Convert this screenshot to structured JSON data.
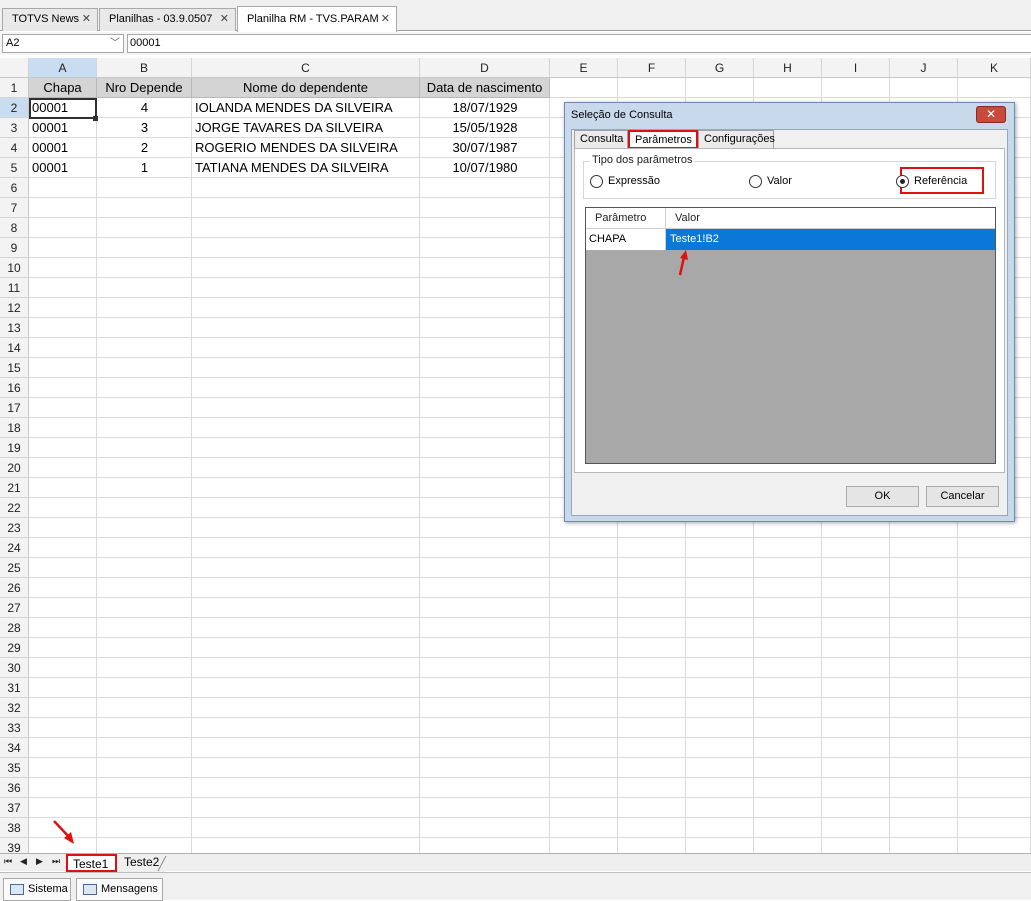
{
  "doc_tabs": [
    {
      "label": "TOTVS News"
    },
    {
      "label": "Planilhas - 03.9.0507"
    },
    {
      "label": "Planilha RM - TVS.PARAM"
    }
  ],
  "formula_bar": {
    "cell_ref": "A2",
    "value": "00001"
  },
  "columns": [
    "A",
    "B",
    "C",
    "D",
    "E",
    "F",
    "G",
    "H",
    "I",
    "J",
    "K"
  ],
  "rows": [
    "1",
    "2",
    "3",
    "4",
    "5",
    "6",
    "7",
    "8",
    "9",
    "10",
    "11",
    "12",
    "13",
    "14",
    "15",
    "16",
    "17",
    "18",
    "19",
    "20",
    "21",
    "22",
    "23",
    "24",
    "25",
    "26",
    "27",
    "28",
    "29",
    "30",
    "31",
    "32",
    "33",
    "34",
    "35",
    "36",
    "37",
    "38",
    "39"
  ],
  "sheet": {
    "headers": [
      "Chapa",
      "Nro Depende",
      "Nome do dependente",
      "Data de nascimento"
    ],
    "data": [
      [
        "00001",
        "4",
        "IOLANDA  MENDES DA SILVEIRA",
        "18/07/1929"
      ],
      [
        "00001",
        "3",
        "JORGE TAVARES DA SILVEIRA",
        "15/05/1928"
      ],
      [
        "00001",
        "2",
        "ROGERIO MENDES DA SILVEIRA",
        "30/07/1987"
      ],
      [
        "00001",
        "1",
        "TATIANA MENDES DA SILVEIRA",
        "10/07/1980"
      ]
    ]
  },
  "sheet_tabs": [
    {
      "label": "Teste1"
    },
    {
      "label": "Teste2"
    }
  ],
  "status_bar": {
    "sistema": "Sistema",
    "mensagens": "Mensagens"
  },
  "dialog": {
    "title": "Seleção de Consulta",
    "close": "✕",
    "tabs": [
      "Consulta",
      "Parâmetros",
      "Configurações"
    ],
    "group_title": "Tipo dos parâmetros",
    "radios": [
      "Expressão",
      "Valor",
      "Referência"
    ],
    "selected_radio": "Referência",
    "table_headers": [
      "Parâmetro",
      "Valor"
    ],
    "table_rows": [
      {
        "param": "CHAPA",
        "valor": "Teste1!B2"
      }
    ],
    "ok": "OK",
    "cancel": "Cancelar"
  },
  "colors": {
    "highlight_red": "#e01010",
    "selection_blue": "#0a78d7",
    "header_selected": "#c8ddf2"
  },
  "icons": {
    "close": "close-icon",
    "dropdown": "chevron-down-icon",
    "sistema": "monitor-icon",
    "mensagens": "messages-icon"
  }
}
